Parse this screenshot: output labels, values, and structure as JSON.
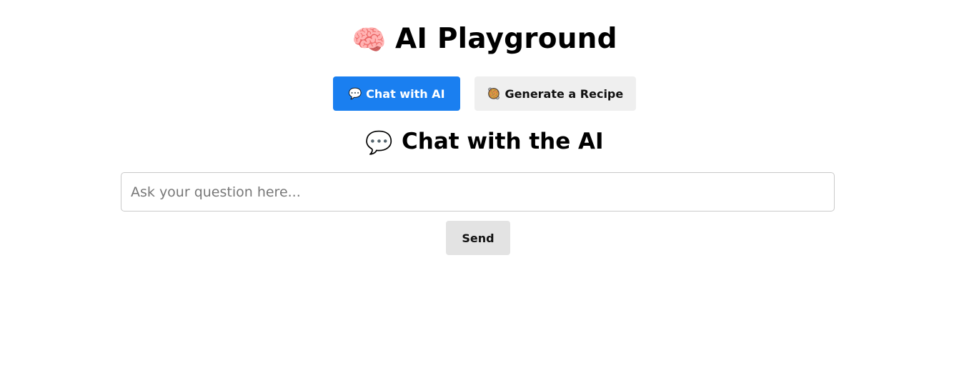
{
  "header": {
    "icon": "🧠",
    "icon_name": "brain-icon",
    "title": "AI Playground"
  },
  "tabs": [
    {
      "icon": "💬",
      "icon_name": "speech-bubble-icon",
      "label": "Chat with AI",
      "active": true
    },
    {
      "icon": "🥘",
      "icon_name": "food-pan-icon",
      "label": "Generate a Recipe",
      "active": false
    }
  ],
  "chat": {
    "icon": "💬",
    "icon_name": "speech-bubble-icon",
    "heading": "Chat with the AI",
    "input_placeholder": "Ask your question here...",
    "input_value": "",
    "send_label": "Send"
  },
  "colors": {
    "accent": "#1a7ff0",
    "inactive_tab": "#efefef",
    "send_button": "#e3e3e3"
  }
}
